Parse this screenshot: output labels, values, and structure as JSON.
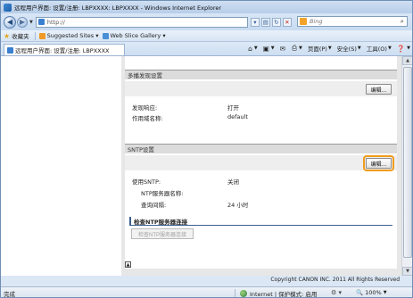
{
  "window": {
    "title": "远程用户界面: 设置/注册: LBPXXXX: LBPXXXX - Windows Internet Explorer"
  },
  "address": {
    "url": "http://",
    "search_provider": "Bing"
  },
  "favorites": {
    "label": "收藏夹",
    "items": [
      "Suggested Sites ▾",
      "Web Slice Gallery ▾"
    ]
  },
  "tab": {
    "title": "远程用户界面: 设置/注册: LBPXXXX"
  },
  "commands": {
    "page": "页面(P)",
    "safety": "安全(S)",
    "tools": "工具(O)"
  },
  "sections": {
    "multicast": {
      "title": "多播发现设置",
      "edit_label": "编辑...",
      "fields": [
        {
          "label": "发现响应:",
          "value": "打开"
        },
        {
          "label": "作用域名称:",
          "value": "default"
        }
      ]
    },
    "sntp": {
      "title": "SNTP设置",
      "edit_label": "编辑...",
      "fields": [
        {
          "label": "使用SNTP:",
          "value": "关闭"
        },
        {
          "label": "NTP服务器名称:",
          "value": ""
        },
        {
          "label": "查询间隔:",
          "value": "24 小时"
        }
      ],
      "check_title": "检查NTP服务器连接",
      "check_button": "检查NTP服务器连接"
    }
  },
  "footer": {
    "copyright": "Copyright CANON INC. 2011 All Rights Reserved"
  },
  "status": {
    "left": "完成",
    "zone": "Internet | 保护模式: 启用",
    "zoom": "100%"
  },
  "colors": {
    "focus_outline": "#f29b1d",
    "section_header": "#dcdcdc",
    "accent_blue": "#3a5f8f"
  }
}
